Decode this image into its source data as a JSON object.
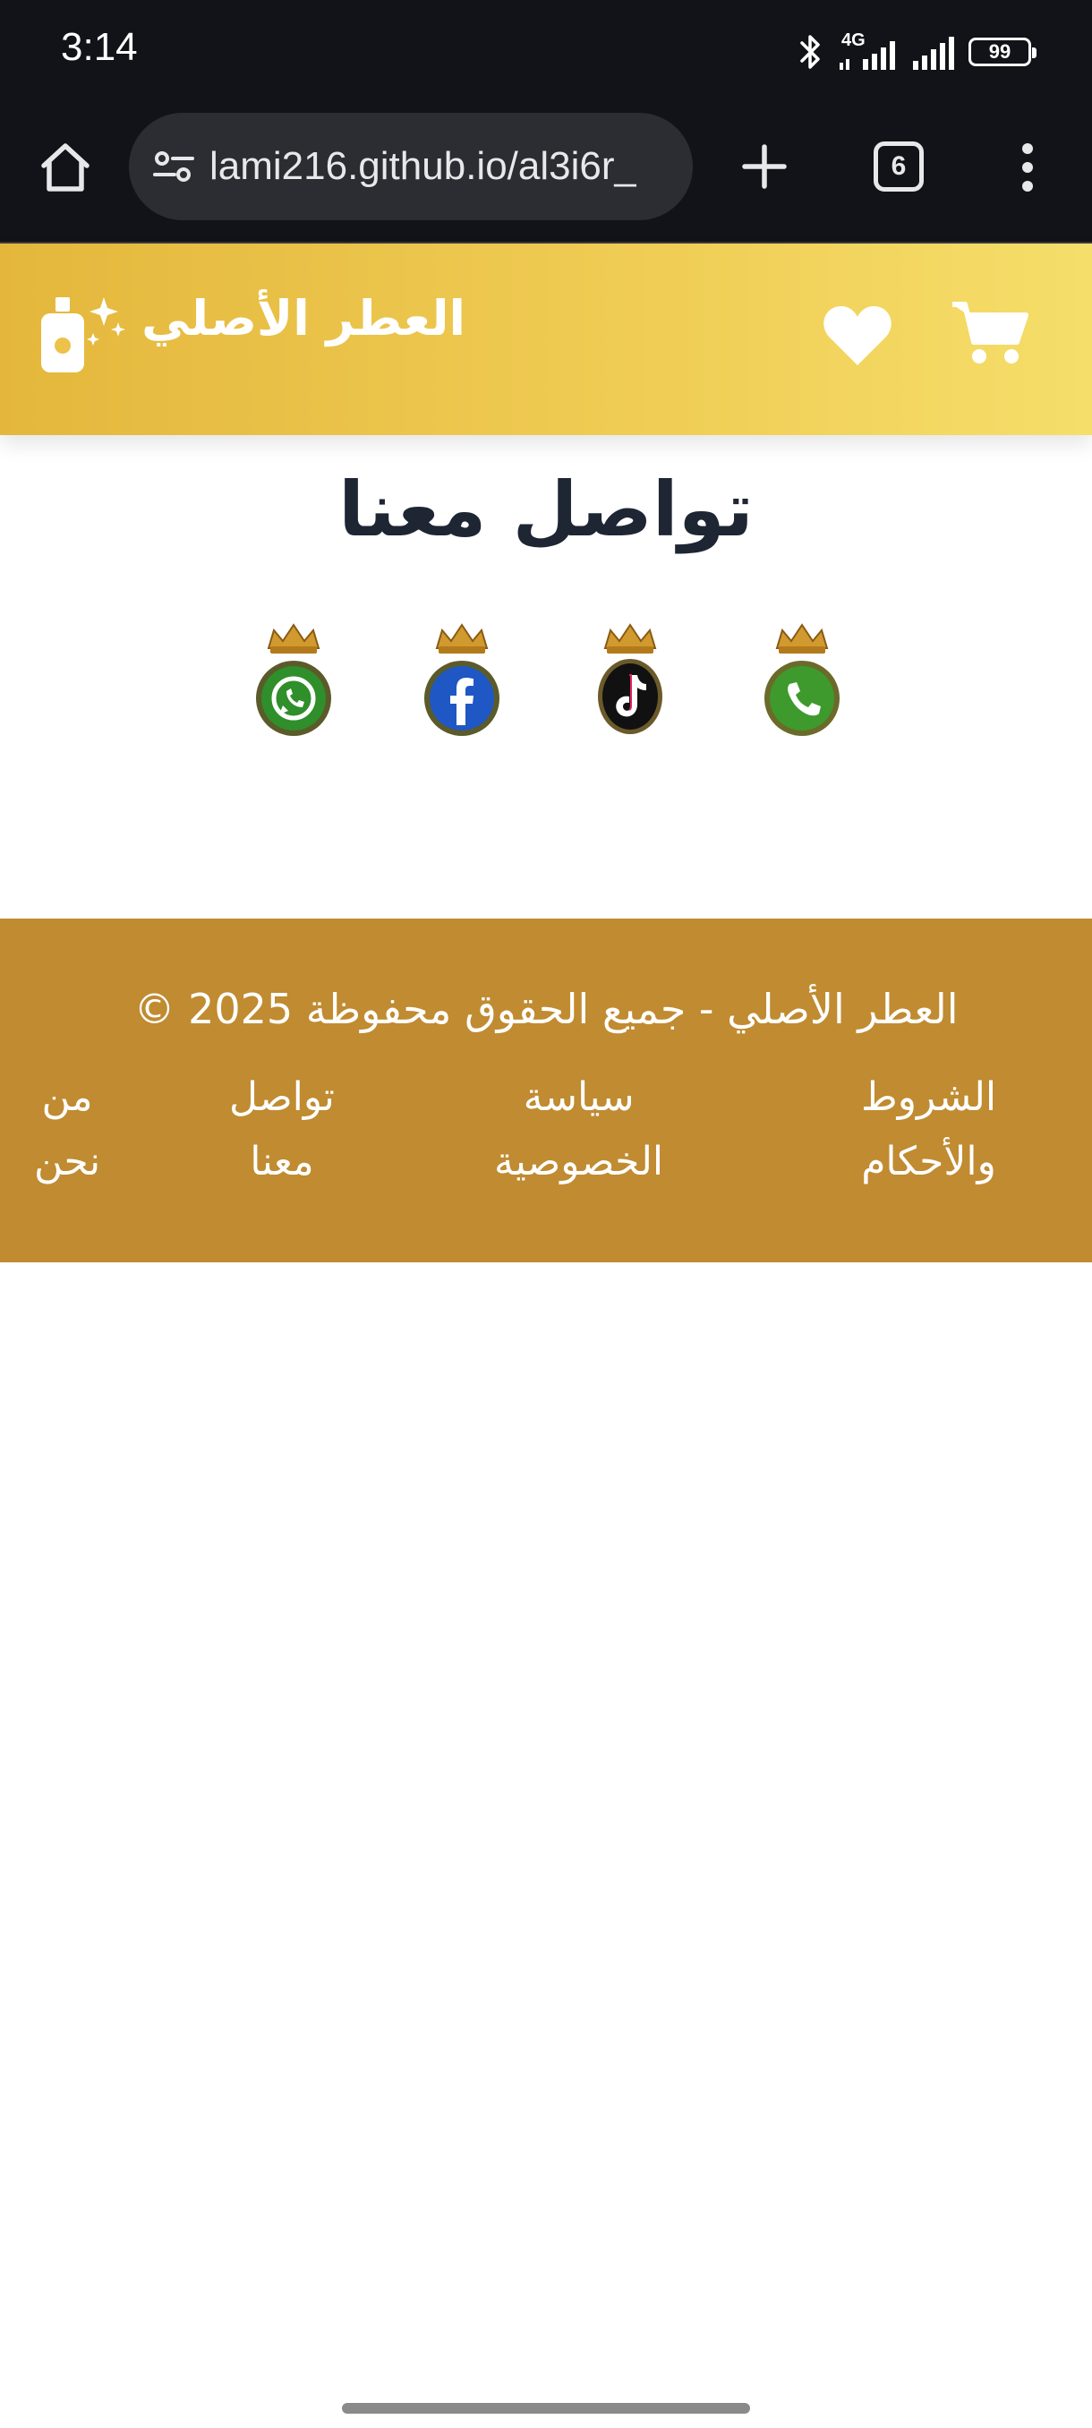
{
  "status_bar": {
    "time": "3:14",
    "network_label": "4G",
    "battery_level": "99",
    "icons": [
      "bluetooth-icon",
      "signal-4g-icon",
      "signal-icon",
      "battery-icon"
    ]
  },
  "browser": {
    "url": "lami216.github.io/al3i6r_",
    "tab_count": "6",
    "icons": [
      "home-icon",
      "tune-icon",
      "plus-icon",
      "tabs-icon",
      "more-vert-icon"
    ]
  },
  "header": {
    "brand_name": "العطر الأصلي",
    "icons": [
      "cart-icon",
      "heart-icon",
      "perfume-bottle-icon"
    ],
    "colors": {
      "gradient_start": "#e4b73c",
      "gradient_end": "#f5de6a",
      "icon": "#ffffff"
    }
  },
  "main": {
    "title": "تواصل معنا",
    "social_links": [
      {
        "icon": "phone-crown-icon",
        "color": "#3e9a2c"
      },
      {
        "icon": "tiktok-crown-icon",
        "color": "#111111"
      },
      {
        "icon": "facebook-crown-icon",
        "color": "#1f57c4"
      },
      {
        "icon": "whatsapp-crown-icon",
        "color": "#2f8f2a"
      }
    ]
  },
  "footer": {
    "copyright_text": "العطر الأصلي - جميع الحقوق محفوظة 2025 ©",
    "links": [
      {
        "line1": "الشروط",
        "line2": "والأحكام"
      },
      {
        "line1": "سياسة",
        "line2": "الخصوصية"
      },
      {
        "line1": "تواصل",
        "line2": "معنا"
      },
      {
        "line1": "من",
        "line2": "نحن"
      }
    ],
    "colors": {
      "background": "#c08b31",
      "text": "#ffffff"
    }
  }
}
